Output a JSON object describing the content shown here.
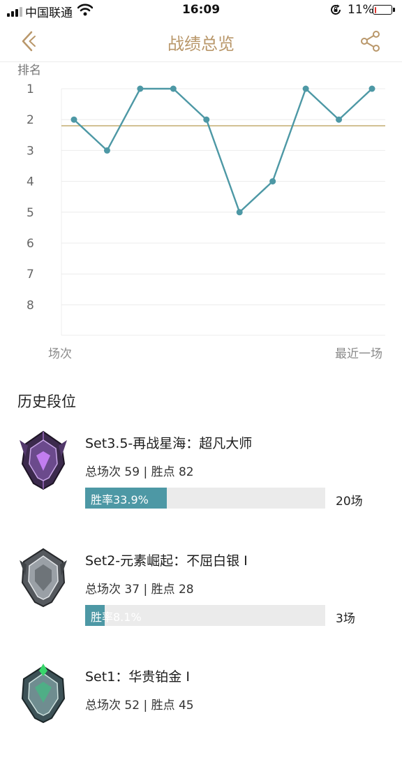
{
  "status_bar": {
    "carrier": "中国联通",
    "time": "16:09",
    "battery_pct": "11%",
    "battery_level": 0.11,
    "battery_color": "#e0342f"
  },
  "nav": {
    "title": "战绩总览",
    "back_icon": "chevron-left-icon",
    "share_icon": "share-icon",
    "accent": "#b9976a"
  },
  "chart_data": {
    "type": "line",
    "ylabel": "排名",
    "xlabel_start": "场次",
    "xlabel_end": "最近一场",
    "y_ticks": [
      "1",
      "2",
      "3",
      "4",
      "5",
      "6",
      "7",
      "8"
    ],
    "ylim": [
      1,
      9
    ],
    "y_inverted": true,
    "reference_line": 2.2,
    "reference_color": "#c7b27a",
    "line_color": "#4d98a5",
    "grid": true,
    "x": [
      1,
      2,
      3,
      4,
      5,
      6,
      7,
      8,
      9,
      10
    ],
    "values": [
      2,
      3,
      1,
      1,
      2,
      5,
      4,
      1,
      2,
      1
    ]
  },
  "history": {
    "title": "历史段位",
    "seasons": [
      {
        "name": "Set3.5-再战星海：超凡大师",
        "stats": "总场次 59 | 胜点 82",
        "win_label": "胜率33.9%",
        "win_rate": 0.339,
        "count": "20场",
        "emblem": "master-emblem-icon"
      },
      {
        "name": "Set2-元素崛起：不屈白银 I",
        "stats": "总场次 37 | 胜点 28",
        "win_label": "胜率8.1%",
        "win_rate": 0.081,
        "count": "3场",
        "emblem": "silver-emblem-icon"
      },
      {
        "name": "Set1：华贵铂金 I",
        "stats": "总场次 52 | 胜点 45",
        "emblem": "platinum-emblem-icon"
      }
    ]
  }
}
